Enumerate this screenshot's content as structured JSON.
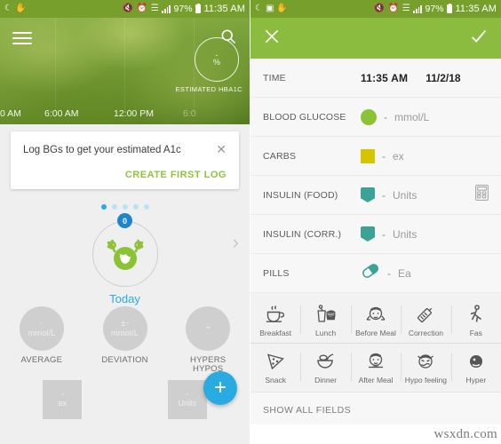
{
  "status_bar": {
    "left_icons": [
      "moon-icon",
      "screenshot-icon",
      "app-icon"
    ],
    "right_icons": [
      "mute-icon",
      "alarm-icon",
      "wifi-icon",
      "signal-icon"
    ],
    "battery_percent": "97%",
    "time": "11:35 AM"
  },
  "left_screen": {
    "appbar": {
      "menu_icon": "hamburger-icon",
      "search_icon": "search-icon"
    },
    "chart": {
      "axis_labels": [
        "0 AM",
        "6:00 AM",
        "12:00 PM",
        "6:0"
      ],
      "a1c_value": "-",
      "a1c_unit": "%",
      "a1c_label": "ESTIMATED HBA1C"
    },
    "promo_card": {
      "message": "Log BGs to get your estimated A1c",
      "close_icon": "close-icon",
      "action_label": "CREATE FIRST LOG"
    },
    "carousel": {
      "dots_total": 5,
      "active_dot_index": 0,
      "badge_count": "0",
      "avatar_icon": "monster-avatar-icon",
      "day_label": "Today",
      "next_icon": "chevron-right-icon"
    },
    "stats": [
      {
        "symbol": "-",
        "unit": "mmol/L",
        "name": "AVERAGE"
      },
      {
        "symbol": "±-",
        "unit": "mmol/L",
        "name": "DEVIATION"
      },
      {
        "symbol": "÷",
        "unit": "",
        "name": "HYPERS\nHYPOS"
      }
    ],
    "tiles": [
      {
        "symbol": "-",
        "unit": "ex"
      },
      {
        "symbol": "-",
        "unit": "Units"
      }
    ],
    "fab": {
      "icon": "plus-icon",
      "color": "#29abe2"
    }
  },
  "right_screen": {
    "topbar": {
      "close_icon": "close-icon",
      "confirm_icon": "check-icon",
      "color": "#8cbc3f"
    },
    "fields": [
      {
        "label": "TIME",
        "type": "time",
        "time": "11:35 AM",
        "date": "11/2/18"
      },
      {
        "label": "BLOOD GLUCOSE",
        "type": "value",
        "swatch": "circle",
        "color": "#8cc334",
        "value": "-",
        "unit": "mmol/L"
      },
      {
        "label": "CARBS",
        "type": "value",
        "swatch": "square",
        "color": "#d4c500",
        "value": "-",
        "unit": "ex"
      },
      {
        "label": "INSULIN (FOOD)",
        "type": "value",
        "swatch": "pen",
        "color": "#3ba396",
        "value": "-",
        "unit": "Units",
        "trailing_icon": "calculator-icon"
      },
      {
        "label": "INSULIN (CORR.)",
        "type": "value",
        "swatch": "pen",
        "color": "#3ba396",
        "value": "-",
        "unit": "Units"
      },
      {
        "label": "PILLS",
        "type": "value",
        "swatch": "pill",
        "color": "#3ba396",
        "value": "-",
        "unit": "Ea"
      }
    ],
    "tag_rows": [
      [
        {
          "icon": "coffee-cup-icon",
          "label": "Breakfast"
        },
        {
          "icon": "burger-drink-icon",
          "label": "Lunch"
        },
        {
          "icon": "face-before-meal-icon",
          "label": "Before Meal"
        },
        {
          "icon": "syringe-icon",
          "label": "Correction"
        },
        {
          "icon": "running-person-icon",
          "label": "Fas"
        }
      ],
      [
        {
          "icon": "pizza-slice-icon",
          "label": "Snack"
        },
        {
          "icon": "bowl-icon",
          "label": "Dinner"
        },
        {
          "icon": "face-after-meal-icon",
          "label": "After Meal"
        },
        {
          "icon": "face-hypo-icon",
          "label": "Hypo feeling"
        },
        {
          "icon": "face-hyper-icon",
          "label": "Hyper"
        }
      ]
    ],
    "show_all_fields": "SHOW ALL FIELDS"
  },
  "watermark": "wsxdn.com"
}
